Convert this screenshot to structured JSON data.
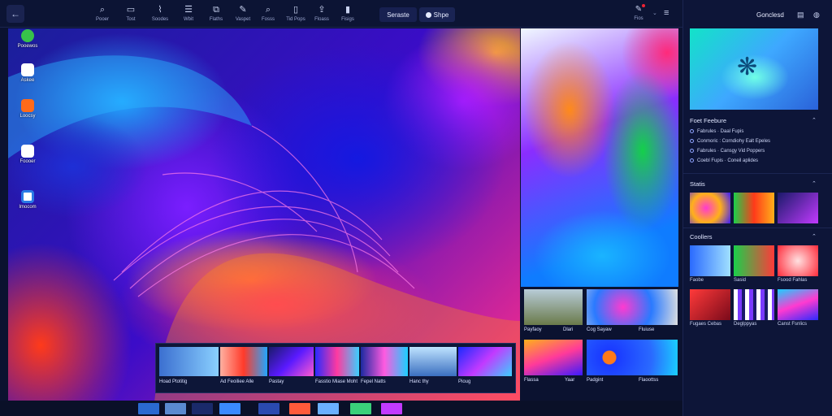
{
  "toolbar": {
    "tools": [
      {
        "label": "Pooer",
        "icon": "search-icon"
      },
      {
        "label": "Tost",
        "icon": "image-icon"
      },
      {
        "label": "Soodes",
        "icon": "brush-icon"
      },
      {
        "label": "Wbit",
        "icon": "list-icon"
      },
      {
        "label": "Flaths",
        "icon": "frame-icon"
      },
      {
        "label": "Vaspet",
        "icon": "pen-icon"
      },
      {
        "label": "Fosss",
        "icon": "search-icon"
      },
      {
        "label": "Tid Pops",
        "icon": "document-icon"
      },
      {
        "label": "Floass",
        "icon": "upload-icon"
      },
      {
        "label": "Fisigs",
        "icon": "bottle-icon"
      }
    ],
    "separate_label": "Seraste",
    "shape_label": "Shpe",
    "right_tool_label": "Fios"
  },
  "left_icons": [
    {
      "label": "Pooewos",
      "color": "#37c24a"
    },
    {
      "label": "Askee",
      "color": "#e33a2c"
    },
    {
      "label": "Loocsy",
      "color": "#ff6a1a"
    },
    {
      "label": "Foooer",
      "color": "#ffffff"
    },
    {
      "label": "Imocom",
      "color": "#2a7be6"
    }
  ],
  "film_strip": [
    {
      "label": "Hoad Ptotitig"
    },
    {
      "label": "Ad Feoiliee Alle"
    },
    {
      "label": "Pastay"
    },
    {
      "label": "Fasstio Miase Moht"
    },
    {
      "label": "Fepel Natts"
    },
    {
      "label": "Hanc thy"
    },
    {
      "label": "Pioug"
    }
  ],
  "gallery": [
    {
      "label1": "Payfaoy",
      "label2": "Dlari"
    },
    {
      "label1": "Cog Sayaw",
      "label2": "Fluiuse"
    },
    {
      "label1": "Flassa",
      "label2": "Yaar"
    },
    {
      "label1": "Padgint",
      "label2": "Flaoottss"
    }
  ],
  "right_panel": {
    "title": "Gonclesd",
    "features_title": "Foet Feebure",
    "features": [
      "Fabrules · Daal Fupis",
      "Conmoric : Corndiohy Ealt Epeles",
      "Fabrules · Cansgy Vid Poppers",
      "Coebl Fupis · Coneil aplides"
    ],
    "stats_title": "Statis",
    "collections_title": "Coollers",
    "collections": [
      {
        "label": "Faobe"
      },
      {
        "label": "Sasid"
      },
      {
        "label": "Fsood Fahlas"
      },
      {
        "label": "Fugaes Cebas"
      },
      {
        "label": "Deglppyas"
      },
      {
        "label": "Canst Fsnlics"
      }
    ]
  }
}
